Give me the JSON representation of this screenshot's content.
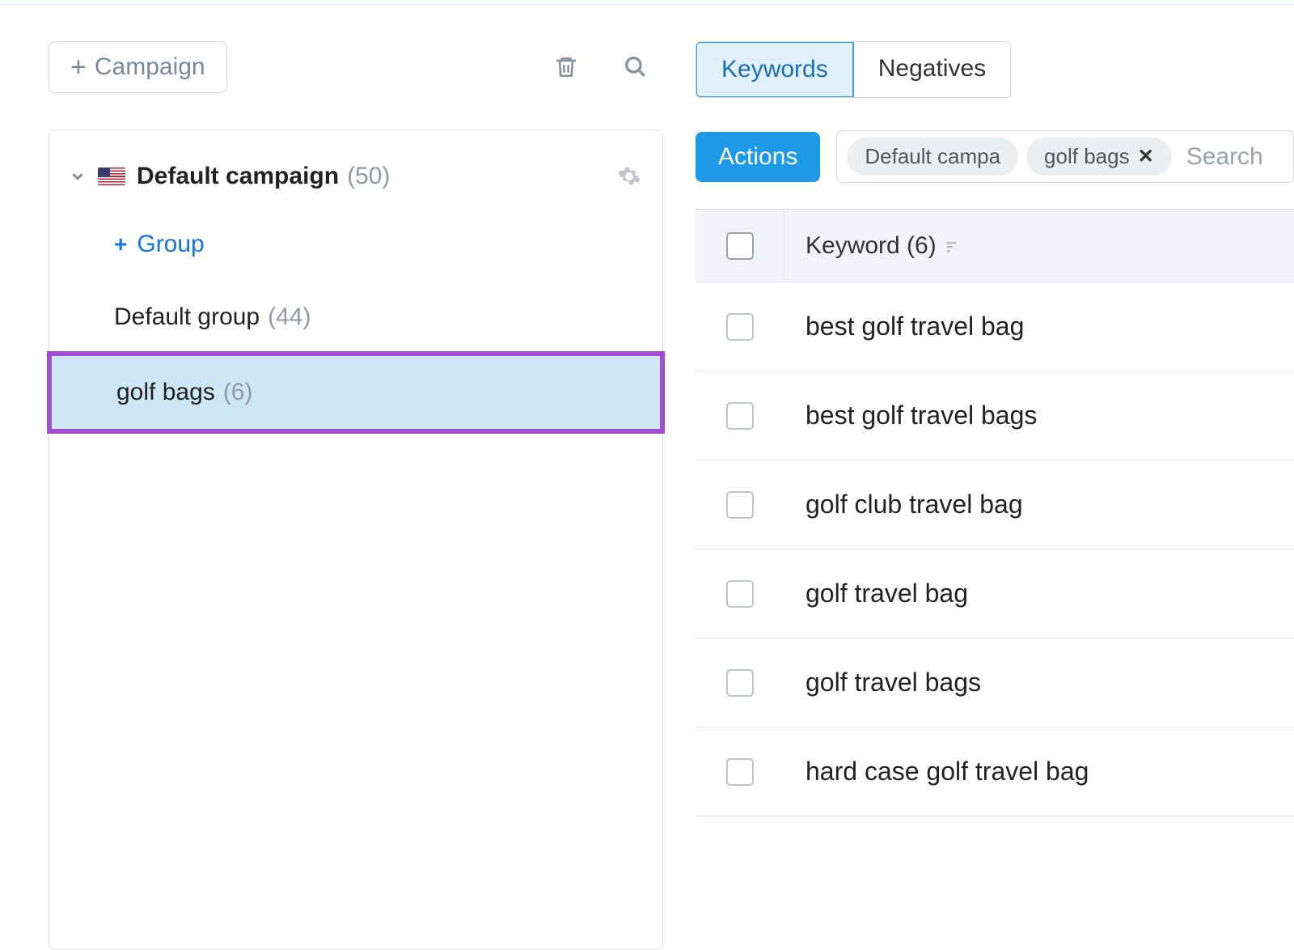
{
  "toolbar": {
    "add_campaign_label": "Campaign"
  },
  "sidebar": {
    "campaign": {
      "name": "Default campaign",
      "count": "(50)"
    },
    "add_group_label": "Group",
    "groups": [
      {
        "name": "Default group",
        "count": "(44)",
        "selected": false
      },
      {
        "name": "golf bags",
        "count": "(6)",
        "selected": true
      }
    ]
  },
  "tabs": {
    "keywords": "Keywords",
    "negatives": "Negatives",
    "active": "keywords"
  },
  "actions_button": "Actions",
  "filter_chips": [
    {
      "label": "Default campa",
      "closable": false
    },
    {
      "label": "golf bags",
      "closable": true
    }
  ],
  "search_placeholder": "Search",
  "table": {
    "header_label": "Keyword (6)",
    "rows": [
      "best golf travel bag",
      "best golf travel bags",
      "golf club travel bag",
      "golf travel bag",
      "golf travel bags",
      "hard case golf travel bag"
    ]
  }
}
